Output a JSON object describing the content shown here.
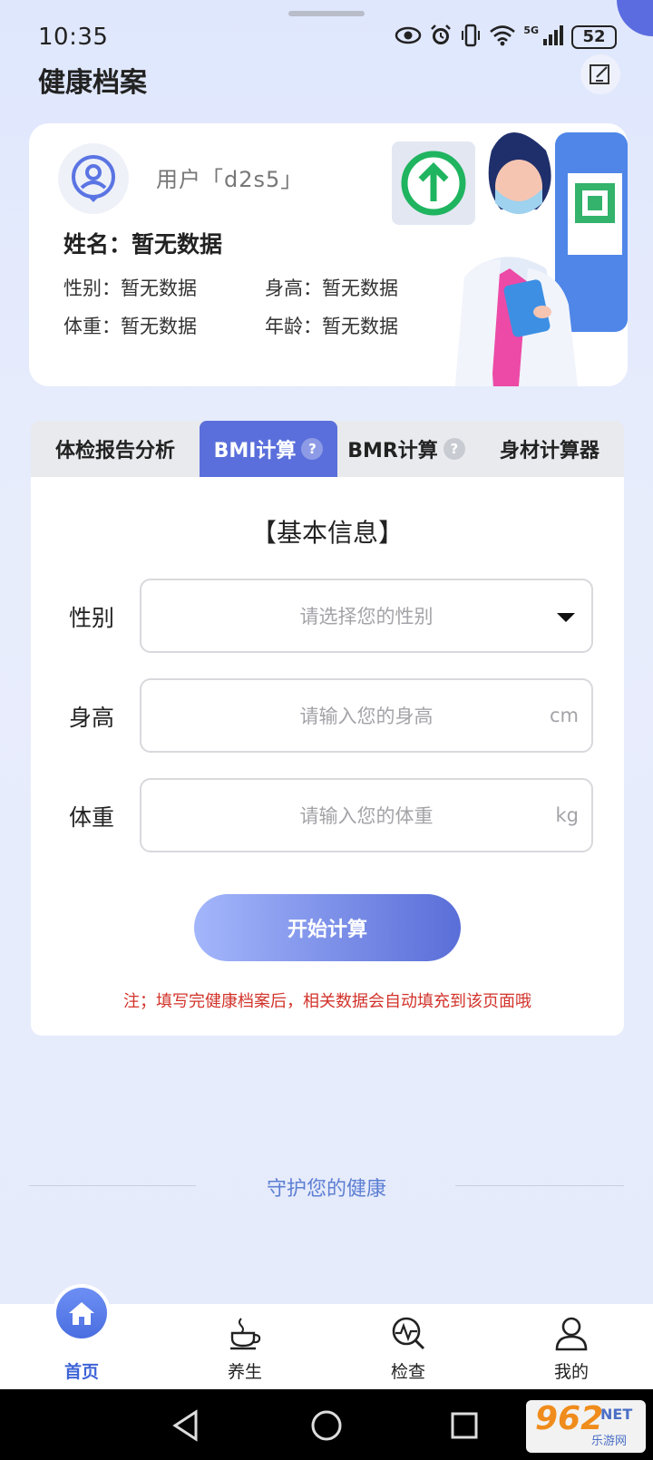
{
  "status_bar": {
    "time": "10:35",
    "network": "5G",
    "battery": "52"
  },
  "header": {
    "title": "健康档案"
  },
  "profile": {
    "username": "用户「d2s5」",
    "name_label": "姓名：暂无数据",
    "gender": "性别：暂无数据",
    "height": "身高：暂无数据",
    "weight": "体重：暂无数据",
    "age": "年龄：暂无数据"
  },
  "tabs": [
    {
      "label": "体检报告分析",
      "active": false
    },
    {
      "label": "BMI计算",
      "active": true,
      "help": "?"
    },
    {
      "label": "BMR计算",
      "active": false,
      "help": "?"
    },
    {
      "label": "身材计算器",
      "active": false
    }
  ],
  "form": {
    "section_title": "【基本信息】",
    "gender_label": "性别",
    "gender_placeholder": "请选择您的性别",
    "height_label": "身高",
    "height_placeholder": "请输入您的身高",
    "height_unit": "cm",
    "weight_label": "体重",
    "weight_placeholder": "请输入您的体重",
    "weight_unit": "kg",
    "submit_label": "开始计算",
    "note": "注；填写完健康档案后，相关数据会自动填充到该页面哦"
  },
  "slogan": "守护您的健康",
  "bottom_nav": [
    {
      "label": "首页",
      "icon": "home-icon",
      "active": true
    },
    {
      "label": "养生",
      "icon": "tea-cup-icon",
      "active": false
    },
    {
      "label": "检查",
      "icon": "health-check-icon",
      "active": false
    },
    {
      "label": "我的",
      "icon": "profile-icon",
      "active": false
    }
  ],
  "watermark": {
    "big": "962",
    "net": "NET",
    "small": "乐游网"
  },
  "colors": {
    "accent": "#5a6fdb",
    "note_red": "#d2332b",
    "slogan_blue": "#5d7fd3"
  }
}
